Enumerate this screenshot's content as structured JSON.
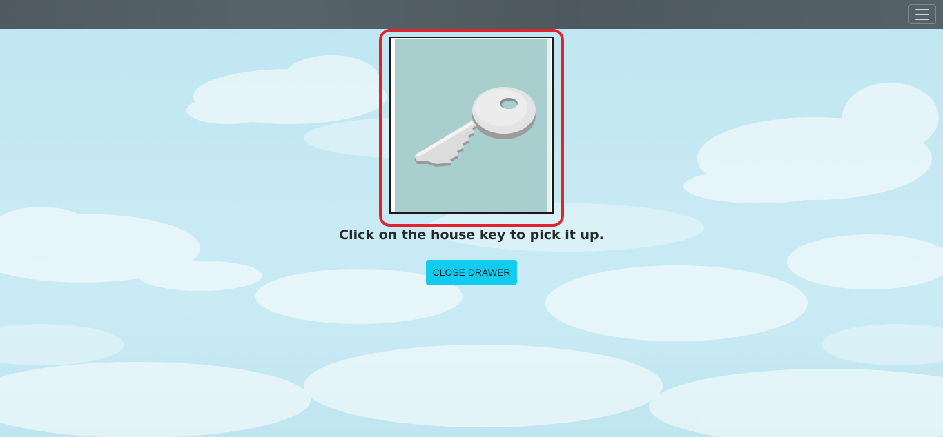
{
  "navbar": {
    "toggle_icon": "hamburger-menu-icon"
  },
  "scene": {
    "object_icon": "house-key-icon",
    "highlight_color": "#e0242e",
    "background_color": "#a8cece"
  },
  "prompt": {
    "text": "Click on the house key to pick it up."
  },
  "actions": {
    "close_drawer_label": "CLOSE DRAWER",
    "button_color": "#13cbef"
  }
}
